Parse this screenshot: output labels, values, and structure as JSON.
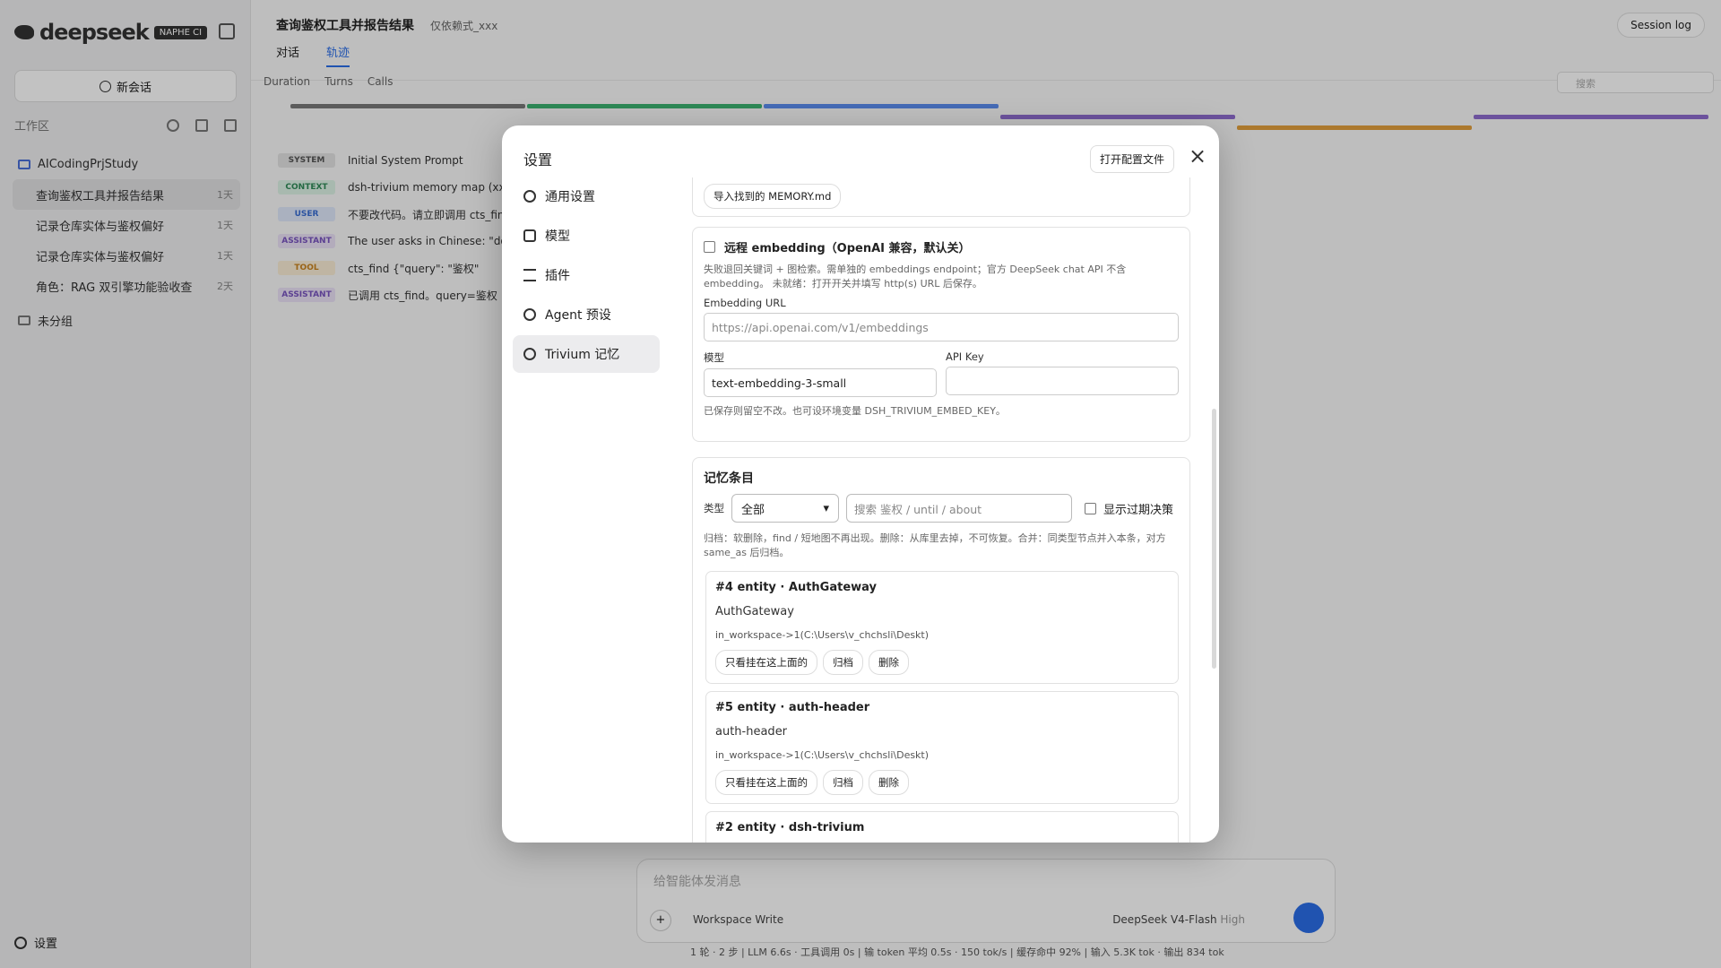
{
  "sidebar": {
    "logo_text": "deepseek",
    "logo_tag": "NAPHE CI",
    "new_chat_label": "新会话",
    "workspace_label": "工作区",
    "project_name": "AICodingPrjStudy",
    "sessions": [
      {
        "title": "查询鉴权工具并报告结果",
        "age": "1天"
      },
      {
        "title": "记录仓库实体与鉴权偏好",
        "age": "1天"
      },
      {
        "title": "记录仓库实体与鉴权偏好",
        "age": "1天"
      },
      {
        "title": "角色：RAG 双引擎功能验收查",
        "age": "2天"
      }
    ],
    "ungrouped_label": "未分组",
    "settings_label": "设置"
  },
  "main": {
    "title": "查询鉴权工具并报告结果",
    "mode": "仅依赖式_xxx",
    "tabs": [
      "对话",
      "轨迹"
    ],
    "active_tab": 1,
    "session_log_label": "Session log",
    "filters": [
      "Duration",
      "Turns",
      "Calls"
    ],
    "search_placeholder": "搜索",
    "rows": [
      {
        "role": "SYSTEM",
        "text": "Initial System Prompt",
        "color": "#9e9e9e"
      },
      {
        "role": "CONTEXT",
        "text": "dsh-trivium memory map (xxx)",
        "color": "#3cb371"
      },
      {
        "role": "USER",
        "text": "不要改代码。请立即调用 cts_find",
        "color": "#5b8def"
      },
      {
        "role": "ASSISTANT",
        "text": "The user asks in Chinese: \"don't...",
        "color": "#8e6ccf"
      },
      {
        "role": "TOOL",
        "text": "cts_find {\"query\": \"鉴权\"",
        "color": "#e3a03d"
      },
      {
        "role": "ASSISTANT",
        "text": "已调用 cts_find。query=鉴权",
        "color": "#8e6ccf"
      }
    ],
    "composer_placeholder": "给智能体发消息",
    "workspace_write_label": "Workspace Write",
    "model_label": "DeepSeek V4-Flash",
    "model_effort": "High",
    "status_line": "1 轮 · 2 步  |  LLM 6.6s · 工具调用 0s  |  输 token 平均 0.5s · 150 tok/s  |  缓存命中 92%  |  输入 5.3K tok · 输出 834 tok"
  },
  "modal": {
    "title": "设置",
    "open_config_label": "打开配置文件",
    "nav": [
      {
        "label": "通用设置",
        "icon": "gear-icon"
      },
      {
        "label": "模型",
        "icon": "database-icon"
      },
      {
        "label": "插件",
        "icon": "sliders-icon"
      },
      {
        "label": "Agent 预设",
        "icon": "agent-icon"
      },
      {
        "label": "Trivium 记忆",
        "icon": "memory-icon"
      }
    ],
    "active_nav": 4,
    "import_memory_label": "导入找到的 MEMORY.md",
    "embedding": {
      "checkbox_label": "远程 embedding（OpenAI 兼容，默认关）",
      "enabled": false,
      "hint": "失败退回关键词 + 图检索。需单独的 embeddings endpoint；官方 DeepSeek chat API 不含 embedding。 未就绪：打开开关并填写 http(s) URL 后保存。",
      "url_label": "Embedding URL",
      "url_placeholder": "https://api.openai.com/v1/embeddings",
      "model_label": "模型",
      "model_value": "text-embedding-3-small",
      "apikey_label": "API Key",
      "apikey_value": "",
      "footer_hint": "已保存则留空不改。也可设环境变量 DSH_TRIVIUM_EMBED_KEY。"
    },
    "memory": {
      "section_title": "记忆条目",
      "type_label": "类型",
      "type_value": "全部",
      "search_placeholder": "搜索  鉴权 / until / about",
      "show_expired_label": "显示过期决策",
      "hint": "归档：软删除，find / 短地图不再出现。删除：从库里去掉，不可恢复。合并：同类型节点并入本条，对方 same_as 后归档。",
      "entries": [
        {
          "header": "#4 entity · AuthGateway",
          "name": "AuthGateway",
          "path": "in_workspace->1(C:\\Users\\v_chchsli\\Deskt)"
        },
        {
          "header": "#5 entity · auth-header",
          "name": "auth-header",
          "path": "in_workspace->1(C:\\Users\\v_chchsli\\Deskt)"
        },
        {
          "header": "#2 entity · dsh-trivium",
          "name": "",
          "path": ""
        }
      ],
      "action_labels": {
        "only_attached": "只看挂在这上面的",
        "archive": "归档",
        "delete": "删除"
      }
    }
  }
}
